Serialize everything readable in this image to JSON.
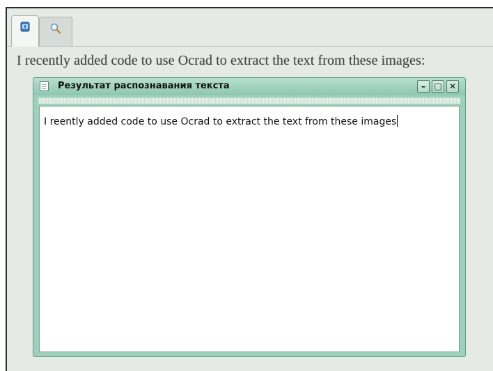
{
  "tabs": [
    {
      "icon": "ocr-document-icon"
    },
    {
      "icon": "magnifier-icon"
    }
  ],
  "image_text": "I recently added code to use Ocrad to extract the text from these images:",
  "dialog": {
    "title": "Результат распознавания текста",
    "minimize_label": "–",
    "maximize_label": "□",
    "close_label": "✕",
    "recognized_text": "I reently added code to use Ocrad to extract the text from these images"
  },
  "colors": {
    "dialog_frame": "#9fd0bd",
    "background": "#e6eae6"
  }
}
